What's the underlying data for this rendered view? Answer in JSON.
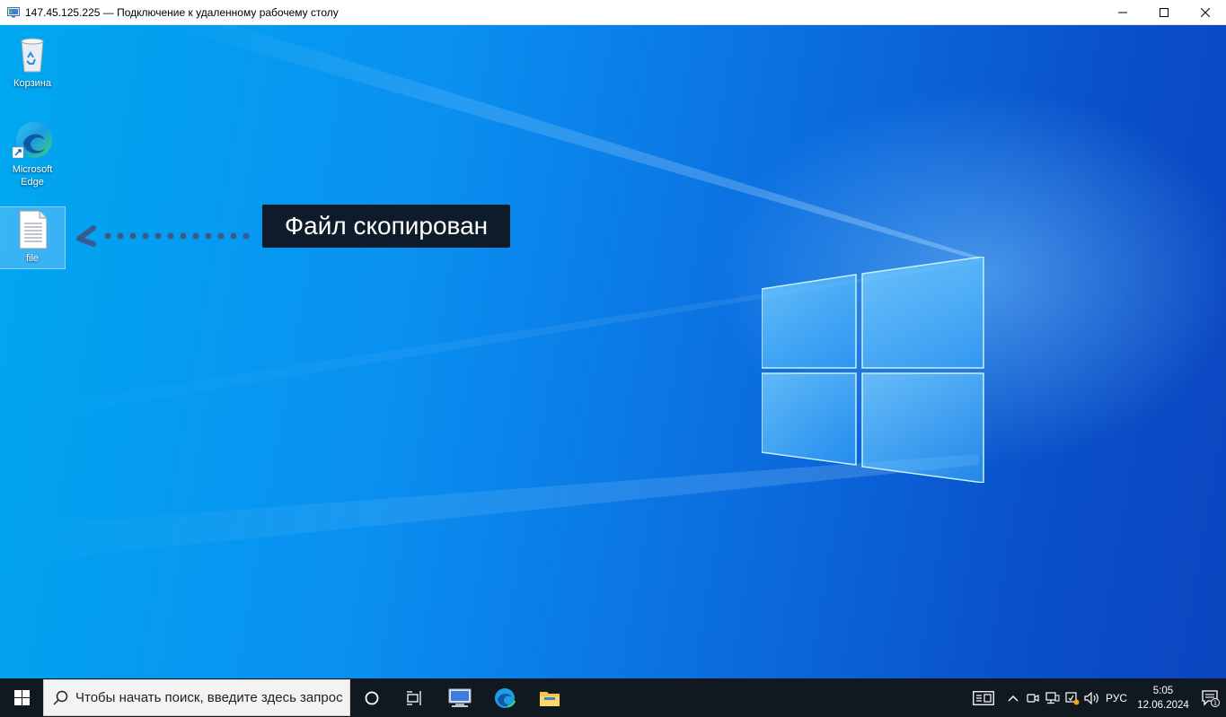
{
  "window": {
    "title": "147.45.125.225 — Подключение к удаленному рабочему столу"
  },
  "desktop": {
    "icons": [
      {
        "label": "Корзина",
        "icon": "recycle-bin-icon"
      },
      {
        "label": "Microsoft Edge",
        "icon": "edge-icon"
      },
      {
        "label": "file",
        "icon": "text-file-icon"
      }
    ],
    "callout": "Файл скопирован"
  },
  "taskbar": {
    "search_placeholder": "Чтобы начать поиск, введите здесь запрос",
    "language": "РУС",
    "time": "5:05",
    "date": "12.06.2024",
    "notification_count": "1"
  }
}
